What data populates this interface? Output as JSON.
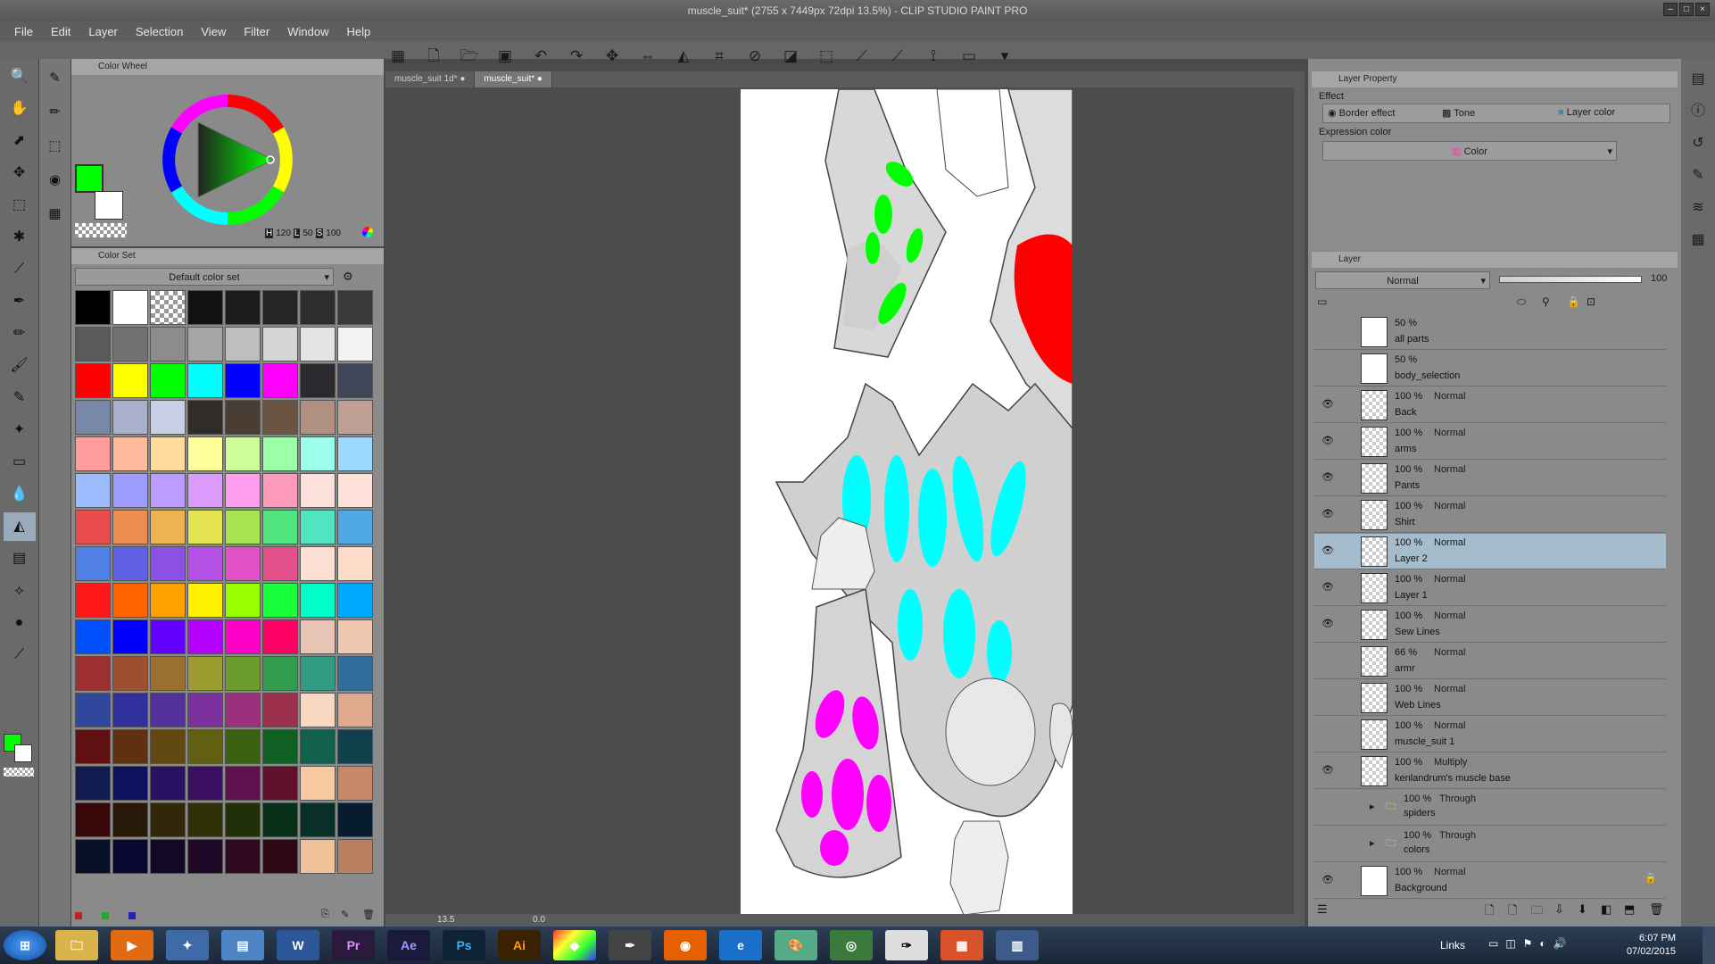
{
  "window": {
    "title": "muscle_suit* (2755 x 7449px 72dpi 13.5%) - CLIP STUDIO PAINT PRO"
  },
  "menu": [
    "File",
    "Edit",
    "Layer",
    "Selection",
    "View",
    "Filter",
    "Window",
    "Help"
  ],
  "toolbar_icons": [
    "grid-icon",
    "new-icon",
    "open-icon",
    "save-icon",
    "undo-icon",
    "redo-icon",
    "transform-icon",
    "flip-icon",
    "fill-icon",
    "crop-icon",
    "deselect-icon",
    "invert-icon",
    "select-icon",
    "ruler-icon",
    "ruler2-icon",
    "perspective-icon",
    "fit-icon",
    "dropdown-icon"
  ],
  "colorwheel": {
    "tab_label": "Color Wheel",
    "h_label": "H",
    "h_value": "120",
    "s_label": "L",
    "s_value": "50",
    "v_label": "S",
    "v_value": "100"
  },
  "colorset": {
    "tab_label": "Color Set",
    "set_name": "Default color set"
  },
  "swatch_colors": [
    "#000000",
    "#ffffff",
    "checker",
    "#111111",
    "#1c1c1c",
    "#262626",
    "#2e2e2e",
    "#3a3a3a",
    "#5a5a5a",
    "#727272",
    "#8c8c8c",
    "#a6a6a6",
    "#bebebe",
    "#d4d4d4",
    "#e4e4e4",
    "#f2f2f2",
    "#ff0000",
    "#ffff00",
    "#00ff00",
    "#00ffff",
    "#0000ff",
    "#ff00ff",
    "#2a2a2e",
    "#3e4658",
    "#7888a8",
    "#a8b0cc",
    "#c8d0e8",
    "#302c28",
    "#4a3e34",
    "#6a5444",
    "#b09080",
    "#c0a094",
    "#ff9c9c",
    "#ffbc9c",
    "#ffdc9c",
    "#fcff9c",
    "#ccff9c",
    "#9cffa8",
    "#9cffec",
    "#9cd8ff",
    "#9cbcff",
    "#9c9cff",
    "#bc9cff",
    "#dc9cff",
    "#ff9cec",
    "#ff9cbc",
    "#fce0dc",
    "#fde0d8",
    "#e84c4c",
    "#ec8c50",
    "#ecb450",
    "#e4e450",
    "#a8e450",
    "#50e47c",
    "#50e4c0",
    "#50a8e4",
    "#5080e4",
    "#6060e4",
    "#8c50e4",
    "#b450e4",
    "#e450c8",
    "#e4508c",
    "#fce0d4",
    "#fcdcc8",
    "#ff1818",
    "#ff6400",
    "#ffa000",
    "#fff000",
    "#96ff00",
    "#18ff3c",
    "#00ffc8",
    "#00a8ff",
    "#0050ff",
    "#0000ff",
    "#6400ff",
    "#b400ff",
    "#ff00c8",
    "#ff0064",
    "#e8c4b4",
    "#f0c8b0",
    "#9c3030",
    "#9c5030",
    "#9c7030",
    "#9c9c30",
    "#6c9c30",
    "#309c4c",
    "#309c84",
    "#306c9c",
    "#30489c",
    "#30309c",
    "#54309c",
    "#7c309c",
    "#9c307c",
    "#9c304c",
    "#f8d8c0",
    "#e0a88c",
    "#601010",
    "#603010",
    "#604810",
    "#606010",
    "#3a6010",
    "#106024",
    "#10604c",
    "#10404c",
    "#101c50",
    "#101060",
    "#2a1060",
    "#3c1060",
    "#601050",
    "#601028",
    "#f8c8a0",
    "#c88868",
    "#380808",
    "#281808",
    "#302808",
    "#303008",
    "#203008",
    "#083018",
    "#083028",
    "#081c30",
    "#081028",
    "#080830",
    "#140828",
    "#200828",
    "#300820",
    "#300814",
    "#f0c098",
    "#b88060"
  ],
  "layer_property": {
    "tab_label": "Layer Property",
    "effect_label": "Effect",
    "border_effect": "Border effect",
    "tone": "Tone",
    "layer_color": "Layer color",
    "expression_color_label": "Expression color",
    "expression_color_value": "Color"
  },
  "layer_panel": {
    "tab_label": "Layer",
    "blend_mode": "Normal",
    "opacity": "100"
  },
  "layers": [
    {
      "opacity": "50 %",
      "mode": "",
      "name": "all parts",
      "visible": false,
      "selected": false
    },
    {
      "opacity": "50 %",
      "mode": "",
      "name": "body_selection",
      "visible": false,
      "selected": false
    },
    {
      "opacity": "100 %",
      "mode": "Normal",
      "name": "Back",
      "visible": true,
      "selected": false
    },
    {
      "opacity": "100 %",
      "mode": "Normal",
      "name": "arms",
      "visible": true,
      "selected": false
    },
    {
      "opacity": "100 %",
      "mode": "Normal",
      "name": "Pants",
      "visible": true,
      "selected": false
    },
    {
      "opacity": "100 %",
      "mode": "Normal",
      "name": "Shirt",
      "visible": true,
      "selected": false
    },
    {
      "opacity": "100 %",
      "mode": "Normal",
      "name": "Layer 2",
      "visible": true,
      "selected": true
    },
    {
      "opacity": "100 %",
      "mode": "Normal",
      "name": "Layer 1",
      "visible": true,
      "selected": false
    },
    {
      "opacity": "100 %",
      "mode": "Normal",
      "name": "Sew Lines",
      "visible": true,
      "selected": false
    },
    {
      "opacity": "66 %",
      "mode": "Normal",
      "name": "armr",
      "visible": false,
      "selected": false
    },
    {
      "opacity": "100 %",
      "mode": "Normal",
      "name": "Web Lines",
      "visible": false,
      "selected": false
    },
    {
      "opacity": "100 %",
      "mode": "Normal",
      "name": "muscle_suit 1",
      "visible": false,
      "selected": false
    },
    {
      "opacity": "100 %",
      "mode": "Multiply",
      "name": "kenlandrum's muscle base",
      "visible": true,
      "selected": false
    },
    {
      "opacity": "100 %",
      "mode": "Through",
      "name": "spiders",
      "visible": false,
      "selected": false
    },
    {
      "opacity": "100 %",
      "mode": "Through",
      "name": "colors",
      "visible": false,
      "selected": false
    },
    {
      "opacity": "100 %",
      "mode": "Normal",
      "name": "Background",
      "visible": true,
      "selected": false
    }
  ],
  "doc_tabs": [
    "muscle_suit 1d*",
    "muscle_suit*"
  ],
  "canvas_status": {
    "zoom": "13.5",
    "angle": "0.0"
  },
  "taskbar": {
    "links_label": "Links",
    "time": "6:07 PM",
    "date": "07/02/2015"
  }
}
